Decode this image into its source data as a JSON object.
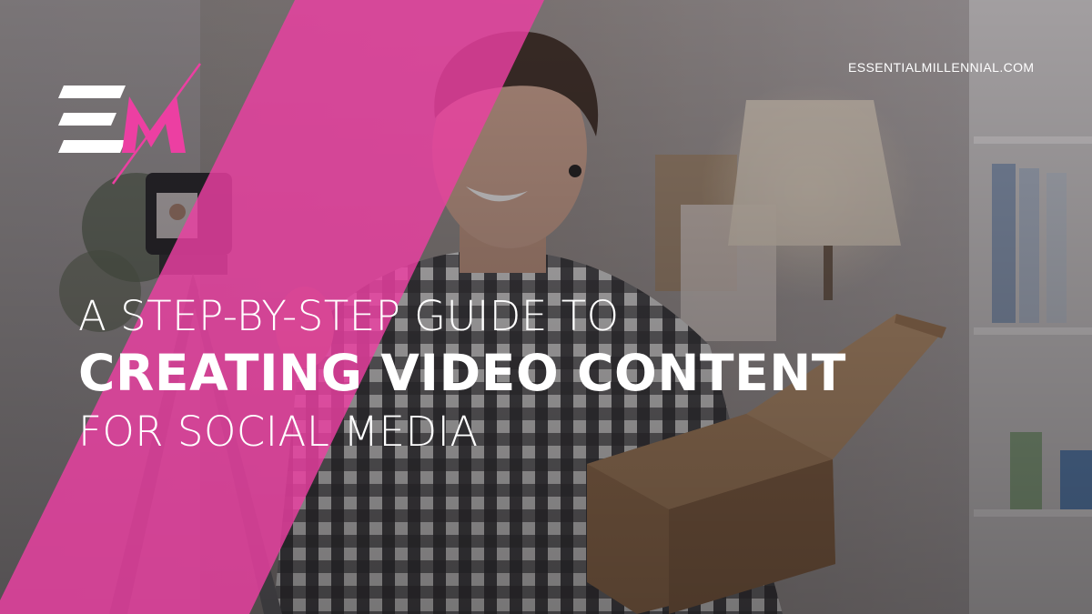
{
  "site": {
    "url": "ESSENTIALMILLENNIAL.COM"
  },
  "brand": {
    "logo_text": "EM",
    "accent": "#ec3fa2"
  },
  "headline": {
    "line1": "A STEP-BY-STEP GUIDE TO",
    "line2": "CREATING VIDEO CONTENT",
    "line3": "FOR SOCIAL MEDIA"
  }
}
